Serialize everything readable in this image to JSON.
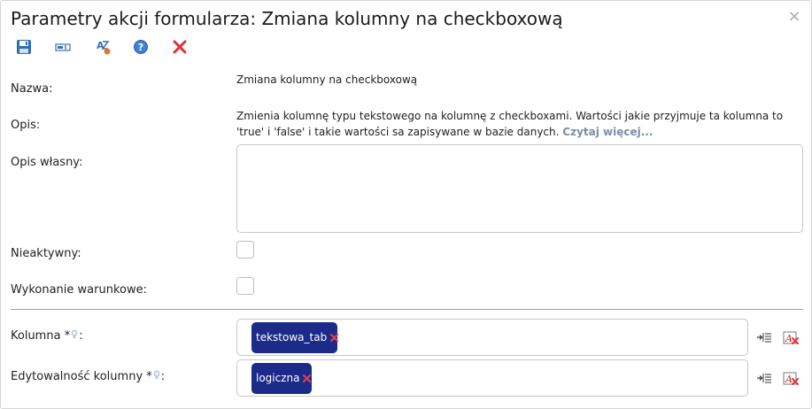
{
  "dialog": {
    "title": "Parametry akcji formularza: Zmiana kolumny na checkboxową",
    "close_glyph": "×"
  },
  "toolbar": {
    "items": [
      {
        "name": "save",
        "icon": "floppy-disk-icon"
      },
      {
        "name": "rename",
        "icon": "textbox-icon"
      },
      {
        "name": "spellcheck",
        "icon": "spellcheck-icon"
      },
      {
        "name": "help",
        "icon": "question-icon"
      },
      {
        "name": "delete",
        "icon": "red-x-icon"
      }
    ]
  },
  "form": {
    "name_label": "Nazwa:",
    "name_value": "Zmiana kolumny na checkboxową",
    "description_label": "Opis:",
    "description_text": "Zmienia kolumnę typu tekstowego na kolumnę z checkboxami. Wartości jakie przyjmuje ta kolumna to 'true' i 'false' i takie wartości sa zapisywane w bazie danych.",
    "read_more": "Czytaj więcej...",
    "custom_description_label": "Opis własny:",
    "custom_description_value": "",
    "inactive_label": "Nieaktywny:",
    "inactive_checked": false,
    "conditional_label": "Wykonanie warunkowe:",
    "conditional_checked": false,
    "column_label": "Kolumna",
    "column_suffix": ":",
    "column_tag": "tekstowa_tab",
    "editability_label": "Edytowalność kolumny",
    "editability_suffix": ":",
    "editability_tag": "logiczna",
    "required_mark": "*"
  },
  "colors": {
    "tag_bg": "#1c2a8a",
    "separator": "#8ea2b6",
    "link": "#7a8ea3",
    "remove_x": "#e0404a"
  }
}
